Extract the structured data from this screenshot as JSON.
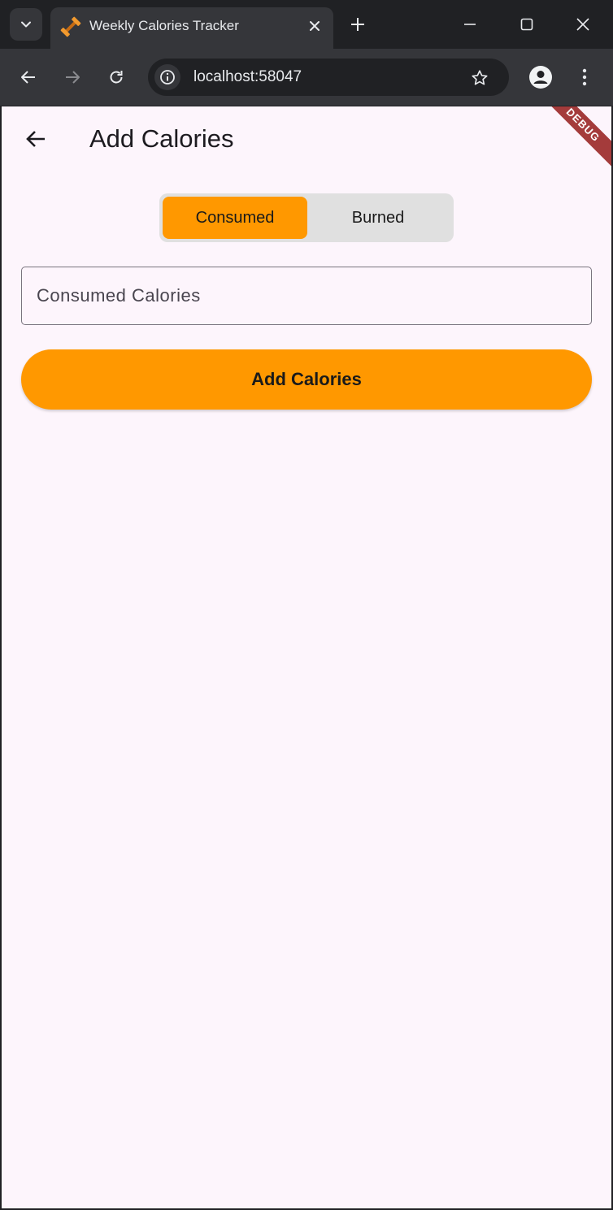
{
  "browser": {
    "tab_title": "Weekly Calories Tracker",
    "url": "localhost:58047"
  },
  "app": {
    "page_title": "Add Calories",
    "debug_banner": "DEBUG",
    "toggle": {
      "options": [
        "Consumed",
        "Burned"
      ],
      "selected": "Consumed"
    },
    "calories_field": {
      "placeholder": "Consumed Calories",
      "value": ""
    },
    "submit_label": "Add Calories"
  },
  "colors": {
    "accent": "#ff9800",
    "background": "#fdf5fc",
    "toggle_track": "#e0e0e0",
    "debug_banner": "#a43b3b"
  },
  "icons": {
    "favicon": "dumbbell-icon",
    "back": "arrow-left-icon"
  }
}
